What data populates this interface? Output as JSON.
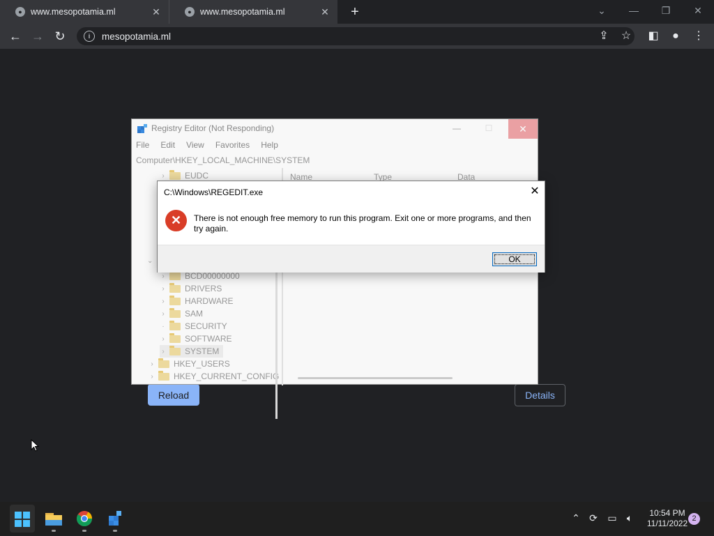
{
  "browser": {
    "tabs": [
      {
        "title": "www.mesopotamia.ml"
      },
      {
        "title": "www.mesopotamia.ml"
      }
    ],
    "url": "mesopotamia.ml"
  },
  "page": {
    "reload_label": "Reload",
    "details_label": "Details"
  },
  "regedit": {
    "title": "Registry Editor (Not Responding)",
    "menu": [
      "File",
      "Edit",
      "View",
      "Favorites",
      "Help"
    ],
    "address": "Computer\\HKEY_LOCAL_MACHINE\\SYSTEM",
    "columns": [
      "Name",
      "Type",
      "Data"
    ],
    "tree": [
      {
        "label": "EUDC",
        "level": 2
      },
      {
        "label": "BCD00000000",
        "level": 2
      },
      {
        "label": "DRIVERS",
        "level": 2
      },
      {
        "label": "HARDWARE",
        "level": 2
      },
      {
        "label": "SAM",
        "level": 2
      },
      {
        "label": "SECURITY",
        "level": 2
      },
      {
        "label": "SOFTWARE",
        "level": 2
      },
      {
        "label": "SYSTEM",
        "level": 2,
        "selected": true
      },
      {
        "label": "HKEY_USERS",
        "level": 1
      },
      {
        "label": "HKEY_CURRENT_CONFIG",
        "level": 1
      }
    ]
  },
  "dialog": {
    "title": "C:\\Windows\\REGEDIT.exe",
    "message_line1": "There is not enough free memory to run this program. Exit one or more programs, and then",
    "message_line2": "try again.",
    "ok_label": "OK"
  },
  "taskbar": {
    "time": "10:54 PM",
    "date": "11/11/2022",
    "notification_count": "2"
  },
  "colors": {
    "page_bg": "#202124",
    "accent": "#8ab4f8",
    "error": "#d93d27"
  }
}
